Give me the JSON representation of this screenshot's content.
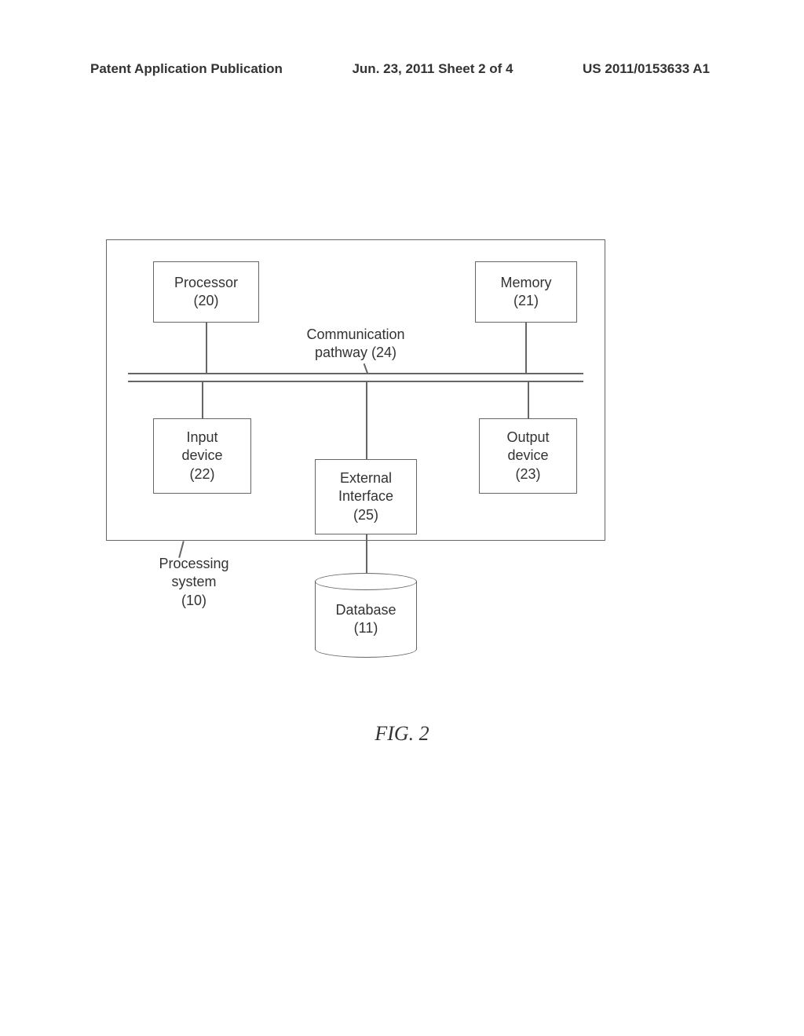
{
  "header": {
    "left": "Patent Application Publication",
    "center": "Jun. 23, 2011  Sheet 2 of 4",
    "right": "US 2011/0153633 A1"
  },
  "diagram": {
    "boxes": {
      "processor": {
        "label": "Processor",
        "ref": "(20)"
      },
      "memory": {
        "label": "Memory",
        "ref": "(21)"
      },
      "input": {
        "label": "Input",
        "label2": "device",
        "ref": "(22)"
      },
      "output": {
        "label": "Output",
        "label2": "device",
        "ref": "(23)"
      },
      "external": {
        "label": "External",
        "label2": "Interface",
        "ref": "(25)"
      }
    },
    "comm_pathway": {
      "label": "Communication",
      "label2": "pathway (24)"
    },
    "processing_system": {
      "label": "Processing",
      "label2": "system",
      "ref": "(10)"
    },
    "database": {
      "label": "Database",
      "ref": "(11)"
    }
  },
  "figure_label": "FIG. 2"
}
